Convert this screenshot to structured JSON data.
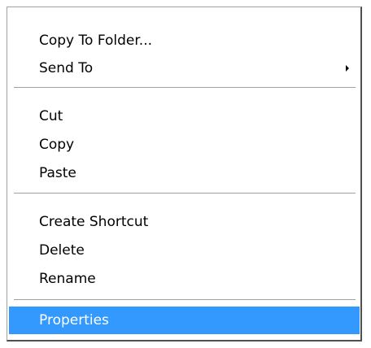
{
  "menu": {
    "items": [
      {
        "label": "Copy To Folder..."
      },
      {
        "label": "Send To"
      },
      {
        "label": "Cut"
      },
      {
        "label": "Copy"
      },
      {
        "label": "Paste"
      },
      {
        "label": "Create Shortcut"
      },
      {
        "label": "Delete"
      },
      {
        "label": "Rename"
      },
      {
        "label": "Properties"
      }
    ],
    "submenu_icon": "chevron-right-icon",
    "highlight_color": "#3399ff"
  }
}
